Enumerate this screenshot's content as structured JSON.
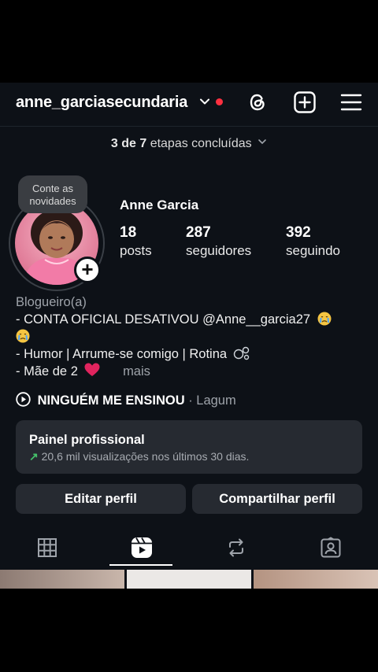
{
  "header": {
    "username": "anne_garciasecundaria"
  },
  "onboarding": {
    "count": "3 de 7",
    "label": "etapas concluídas"
  },
  "profile": {
    "note": "Conte as novidades",
    "full_name": "Anne Garcia",
    "stats": [
      {
        "value": "18",
        "label": "posts"
      },
      {
        "value": "287",
        "label": "seguidores"
      },
      {
        "value": "392",
        "label": "seguindo"
      }
    ]
  },
  "bio": {
    "category": "Blogueiro(a)",
    "line1": "- CONTA OFICIAL DESATIVOU @Anne__garcia27",
    "line2": "- Humor | Arrume-se comigo | Rotina",
    "line3": "- Mãe de 2",
    "more": "mais"
  },
  "music": {
    "song": "NINGUÉM ME ENSINOU",
    "separator": " · ",
    "artist": "Lagum"
  },
  "pro_panel": {
    "title": "Painel profissional",
    "subtitle": "20,6 mil visualizações nos últimos 30 dias."
  },
  "actions": {
    "edit": "Editar perfil",
    "share": "Compartilhar perfil"
  },
  "tabs": [
    "grid-icon",
    "reels-icon",
    "reposts-icon",
    "tagged-icon"
  ],
  "colors": {
    "background": "#0d1117",
    "button": "#262a31",
    "notification_dot": "#ff3040",
    "trend": "#45c26a",
    "heart": "#e0245e"
  }
}
